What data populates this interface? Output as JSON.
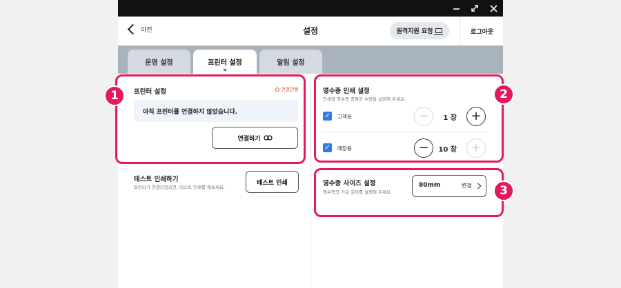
{
  "header": {
    "back_label": "이전",
    "title": "설정",
    "remote_support_label": "원격지원 요청",
    "logout_label": "로그아웃"
  },
  "tabs": [
    {
      "label": "운영 설정",
      "active": false
    },
    {
      "label": "프린터 설정",
      "active": true
    },
    {
      "label": "알림 설정",
      "active": false
    }
  ],
  "printer": {
    "title": "프린터 설정",
    "status": "연결안됨",
    "notice": "아직 프린터를 연결하지 않았습니다.",
    "connect_label": "연결하기"
  },
  "test_print": {
    "title": "테스트 인쇄하기",
    "desc": "프린터가 연결되었으면, 테스트 인쇄를 해보세요.",
    "button_label": "테스트 인쇄"
  },
  "receipt_print": {
    "title": "영수증 인쇄 설정",
    "desc": "인쇄할 영수증 종류와 수량을 설정해 주세요.",
    "rows": [
      {
        "label": "고객용",
        "checked": true,
        "qty": "1 장"
      },
      {
        "label": "매장용",
        "checked": true,
        "qty": "10 장"
      }
    ]
  },
  "receipt_size": {
    "title": "영수증 사이즈 설정",
    "desc": "영수증의 가로 길이를 설정해 주세요.",
    "value": "80mm",
    "change_label": "변경"
  },
  "callouts": [
    "1",
    "2",
    "3"
  ],
  "colors": {
    "callout": "#e3195e",
    "accent": "#2f7de1",
    "status_warning": "#e35d2b",
    "titlebar": "#111111",
    "tabbar": "#a9b3be"
  }
}
